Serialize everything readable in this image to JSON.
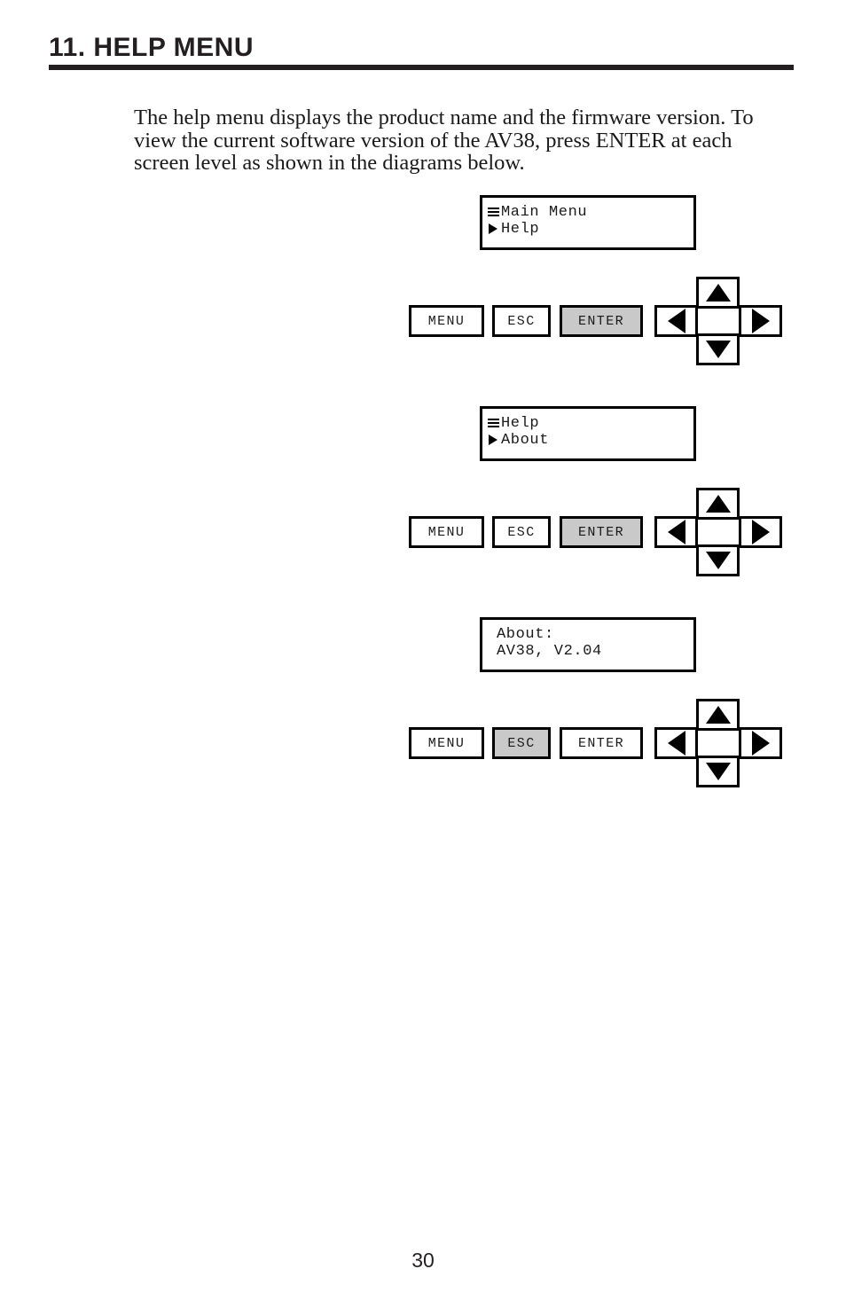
{
  "document": {
    "header": {
      "title": "11. HELP MENU"
    },
    "intro": {
      "paragraph": "The help menu displays the product name and the firmware version.  To view the current software version of the AV38, press ENTER at each screen level as shown in the diagrams below."
    },
    "footer": {
      "page_number": "30"
    }
  },
  "keypad_labels": {
    "menu": "MENU",
    "esc": "ESC",
    "enter": "ENTER",
    "up": "up-arrow",
    "down": "down-arrow",
    "left": "left-arrow",
    "right": "right-arrow"
  },
  "colors": {
    "highlight": "#c9c9c9",
    "ink": "#000000",
    "text": "#1a1a1a",
    "header": "#231f20"
  },
  "steps": [
    {
      "lcd": {
        "line1_icon": "hamburger-menu-icon",
        "line1_text": "Main Menu",
        "line2_icon": "cursor-triangle-icon",
        "line2_text": "Help",
        "indent": false
      },
      "keypad": {
        "menu": "MENU",
        "esc": "ESC",
        "enter": "ENTER",
        "highlight": "enter"
      }
    },
    {
      "lcd": {
        "line1_icon": "hamburger-menu-icon",
        "line1_text": "Help",
        "line2_icon": "cursor-triangle-icon",
        "line2_text": "About",
        "indent": false
      },
      "keypad": {
        "menu": "MENU",
        "esc": "ESC",
        "enter": "ENTER",
        "highlight": "enter"
      }
    },
    {
      "lcd": {
        "line1_icon": "none",
        "line1_text": "About:",
        "line2_icon": "none",
        "line2_text": "AV38, V2.04",
        "indent": true
      },
      "keypad": {
        "menu": "MENU",
        "esc": "ESC",
        "enter": "ENTER",
        "highlight": "esc"
      }
    }
  ]
}
